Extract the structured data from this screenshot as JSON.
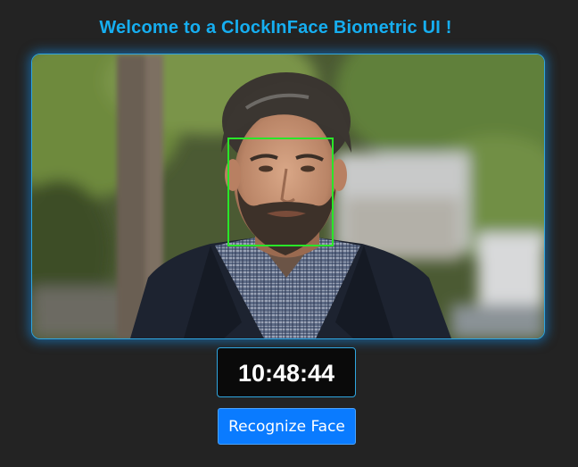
{
  "header": {
    "title": "Welcome to a ClockInFace Biometric UI !"
  },
  "camera": {
    "detection_color": "#29e629",
    "frame_border_color": "#2fa6e0"
  },
  "clock": {
    "time": "10:48:44"
  },
  "actions": {
    "recognize_label": "Recognize Face",
    "button_color": "#0a7bff"
  },
  "theme": {
    "background": "#232323",
    "accent": "#16aef0"
  }
}
